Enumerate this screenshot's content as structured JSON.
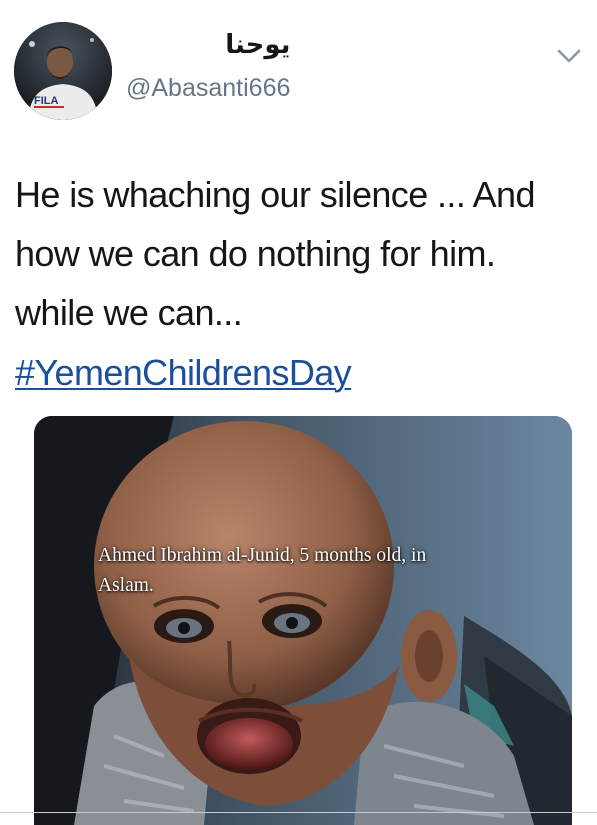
{
  "user": {
    "display_name": "يوحنا",
    "handle": "@Abasanti666",
    "avatar_shirt_text": "FILA"
  },
  "tweet": {
    "text_lines": [
      "He is whaching our silence ... And",
      "how we can do nothing for him.",
      "while we can..."
    ],
    "hashtag": "#YemenChildrensDay"
  },
  "media": {
    "caption_lines": [
      "Ahmed Ibrahim al-Junid, 5 months old, in",
      "Aslam."
    ]
  },
  "icons": {
    "menu": "chevron-down-icon"
  },
  "colors": {
    "text": "#14171a",
    "secondary_text": "#657786",
    "hashtag": "#1b4f9c"
  }
}
